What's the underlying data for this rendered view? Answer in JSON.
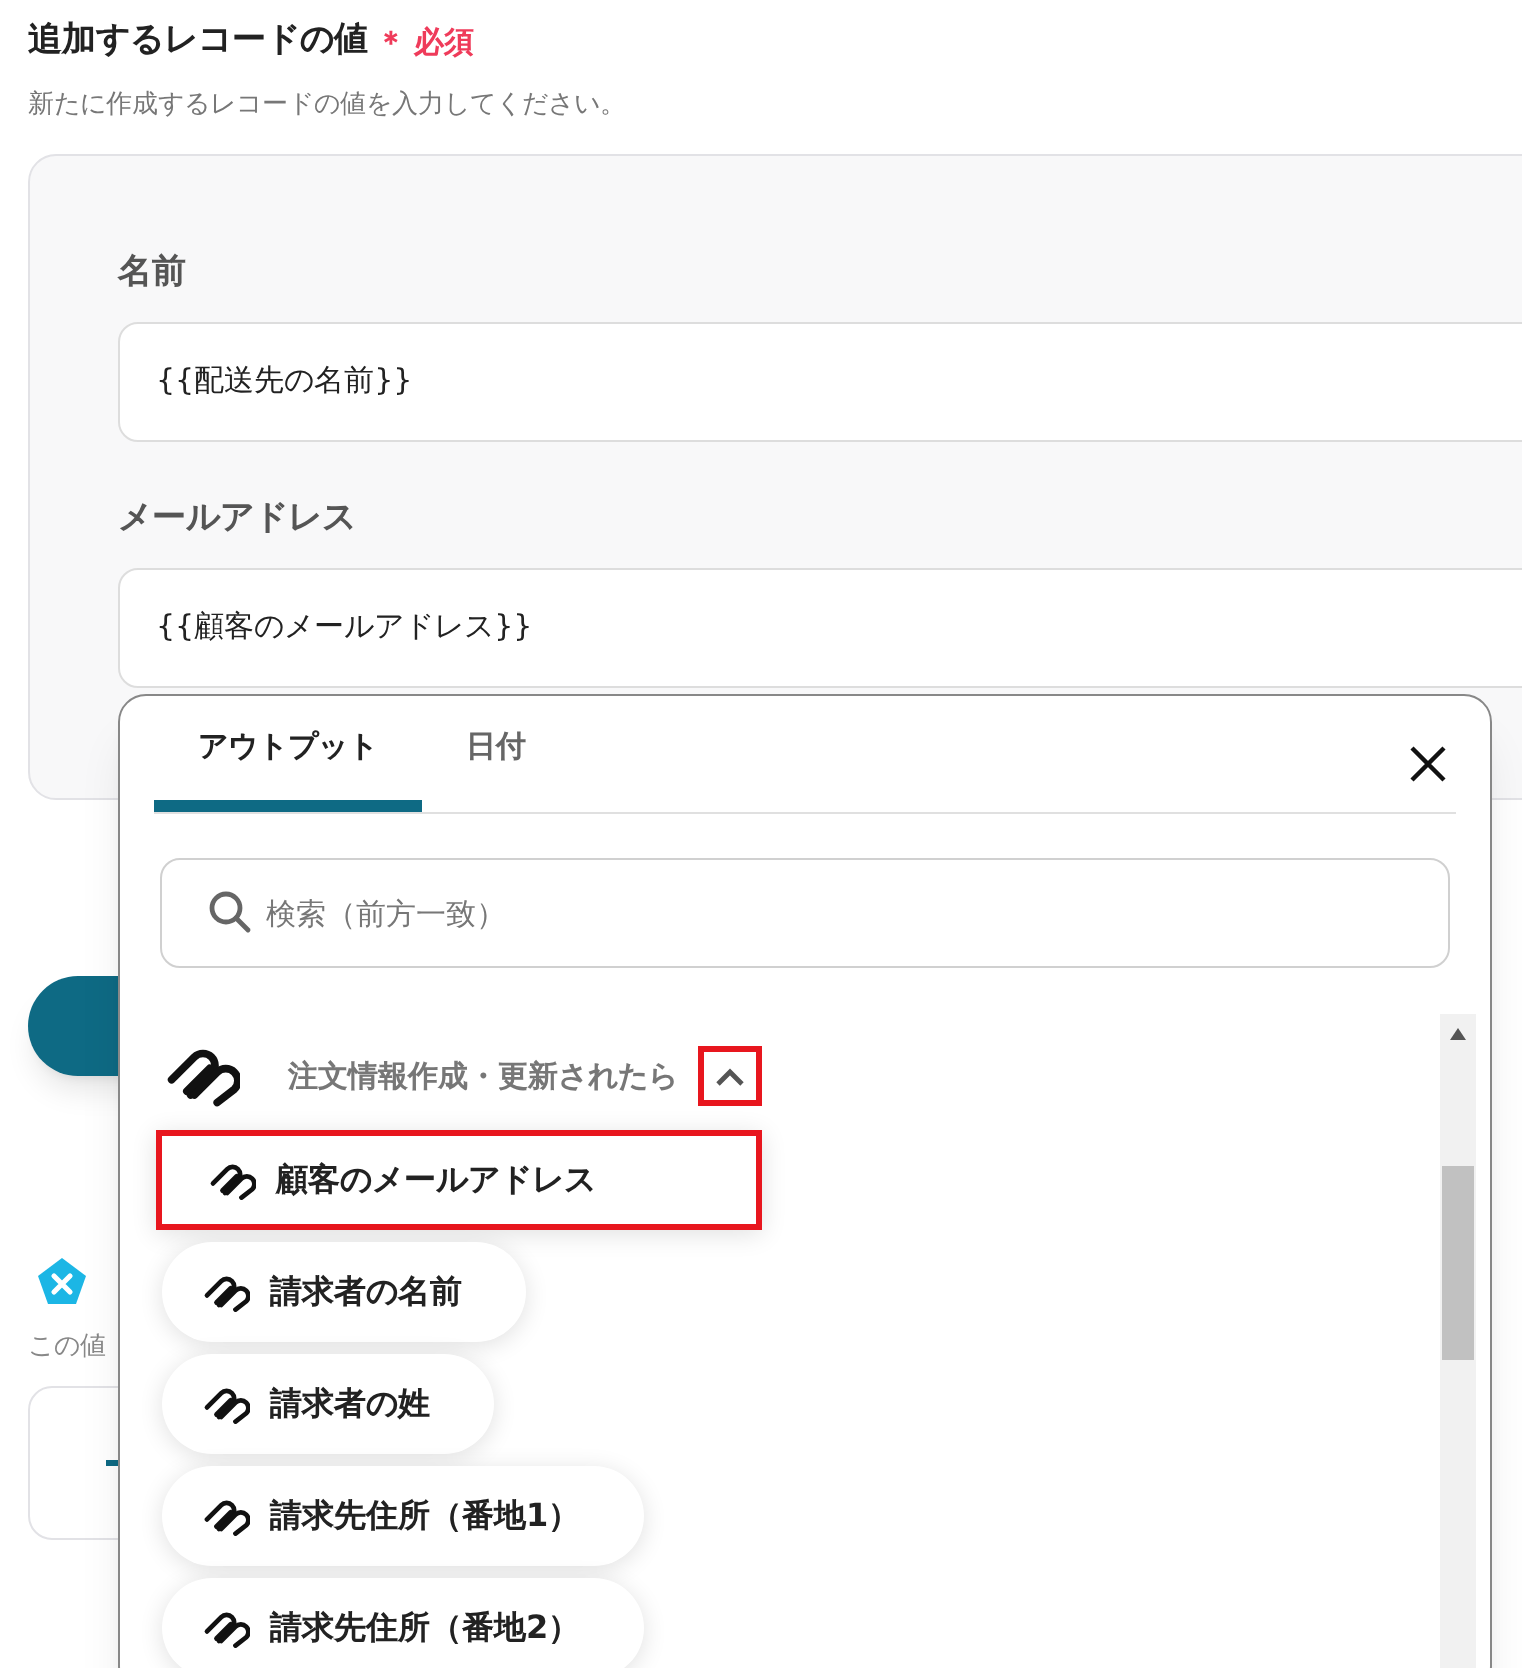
{
  "section": {
    "title": "追加するレコードの値",
    "required_mark": "＊",
    "required_label": "必須",
    "description": "新たに作成するレコードの値を入力してください。"
  },
  "fields": [
    {
      "label": "名前",
      "value": "{{配送先の名前}}"
    },
    {
      "label": "メールアドレス",
      "value": "{{顧客のメールアドレス}}"
    }
  ],
  "background": {
    "note": "この値"
  },
  "popup": {
    "tabs": [
      {
        "label": "アウトプット",
        "selected": true
      },
      {
        "label": "日付",
        "selected": false
      }
    ],
    "search": {
      "placeholder": "検索（前方一致）"
    },
    "group": {
      "title": "注文情報作成・更新されたら",
      "expanded": true,
      "highlighted": true,
      "items": [
        {
          "label": "顧客のメールアドレス",
          "highlighted": true
        },
        {
          "label": "請求者の名前",
          "highlighted": false
        },
        {
          "label": "請求者の姓",
          "highlighted": false
        },
        {
          "label": "請求先住所（番地1）",
          "highlighted": false
        },
        {
          "label": "請求先住所（番地2）",
          "highlighted": false
        }
      ]
    }
  }
}
